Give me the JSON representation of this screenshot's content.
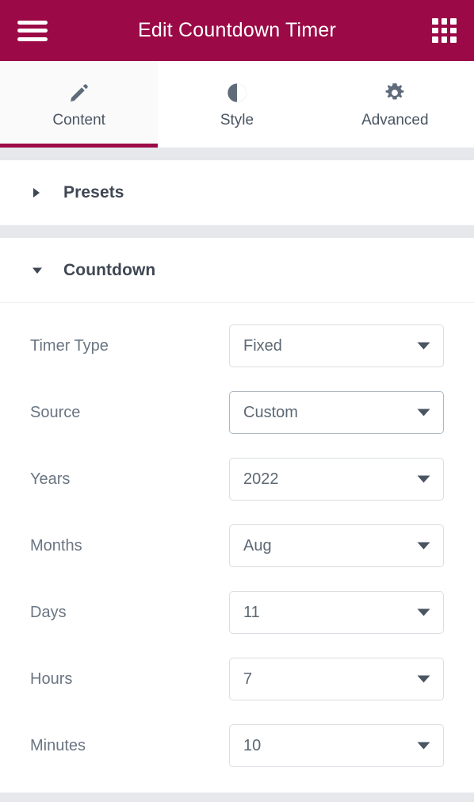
{
  "header": {
    "title": "Edit Countdown Timer",
    "menu_icon": "hamburger-menu-icon",
    "apps_icon": "grid-apps-icon",
    "background_color": "#9b0a46"
  },
  "tabs": [
    {
      "label": "Content",
      "icon": "pencil-icon",
      "active": true
    },
    {
      "label": "Style",
      "icon": "contrast-icon",
      "active": false
    },
    {
      "label": "Advanced",
      "icon": "gear-icon",
      "active": false
    }
  ],
  "sections": [
    {
      "title": "Presets",
      "expanded": false,
      "caret_icon": "chevron-right-icon"
    },
    {
      "title": "Countdown",
      "expanded": true,
      "caret_icon": "chevron-down-icon"
    }
  ],
  "countdown_fields": [
    {
      "label": "Timer Type",
      "value": "Fixed",
      "caret_icon": "chevron-down-icon",
      "focused": false
    },
    {
      "label": "Source",
      "value": "Custom",
      "caret_icon": "chevron-down-icon",
      "focused": true
    },
    {
      "label": "Years",
      "value": "2022",
      "caret_icon": "chevron-down-icon",
      "focused": false
    },
    {
      "label": "Months",
      "value": "Aug",
      "caret_icon": "chevron-down-icon",
      "focused": false
    },
    {
      "label": "Days",
      "value": "11",
      "caret_icon": "chevron-down-icon",
      "focused": false
    },
    {
      "label": "Hours",
      "value": "7",
      "caret_icon": "chevron-down-icon",
      "focused": false
    },
    {
      "label": "Minutes",
      "value": "10",
      "caret_icon": "chevron-down-icon",
      "focused": false
    }
  ],
  "colors": {
    "accent": "#9b0a46",
    "label_text": "#6a7582",
    "value_text": "#5c6874",
    "section_text": "#3f4754",
    "divider": "#e6e8eb"
  }
}
